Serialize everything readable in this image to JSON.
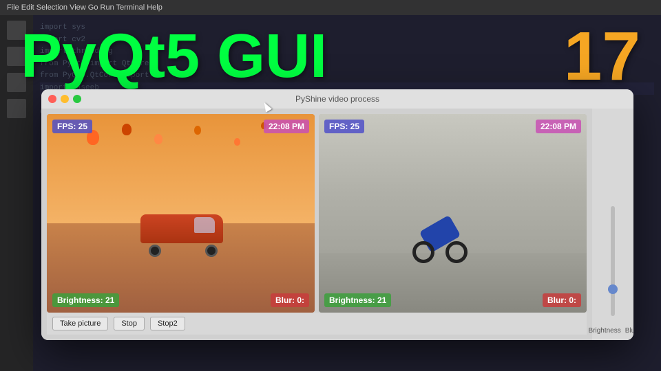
{
  "window": {
    "title": "PyShine video process"
  },
  "titleOverlay": {
    "text": "PyQt5 GUI",
    "number": "17"
  },
  "leftPanel": {
    "fps": "FPS: 25",
    "time": "22:08 PM",
    "brightness": "Brightness: 21",
    "blur": "Blur: 0:"
  },
  "rightPanel": {
    "fps": "FPS: 25",
    "time": "22:08 PM",
    "brightness": "Brightness: 21",
    "blur": "Blur: 0:"
  },
  "buttons": {
    "takePicture": "Take picture",
    "stop": "Stop",
    "stop2": "Stop2"
  },
  "sliderLabels": {
    "brightness": "Brightness",
    "blur": "Blur"
  }
}
